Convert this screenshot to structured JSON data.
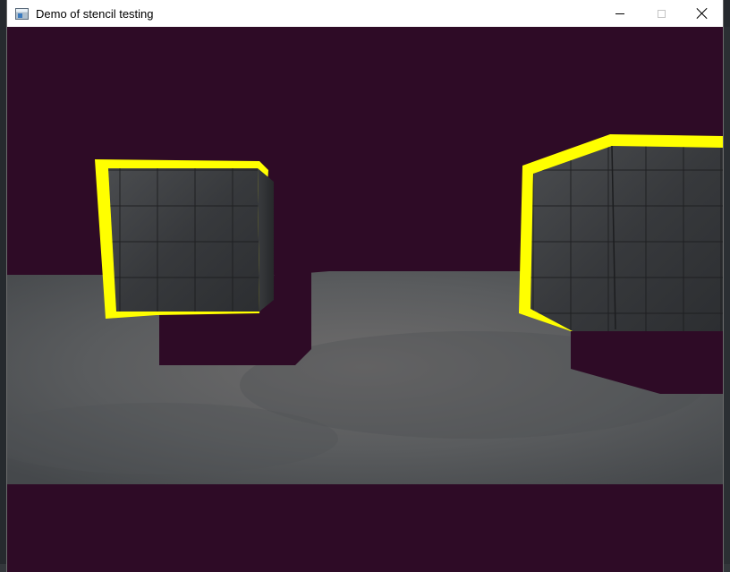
{
  "window": {
    "title": "Demo of stencil testing",
    "controls": {
      "minimize": "minimize",
      "maximize": "maximize",
      "close": "close"
    }
  },
  "scene": {
    "clear_color": "#2e0b26",
    "outline_color": "#ffff00",
    "floor_color": "#5f6163",
    "crate_color": "#3b3d40"
  }
}
